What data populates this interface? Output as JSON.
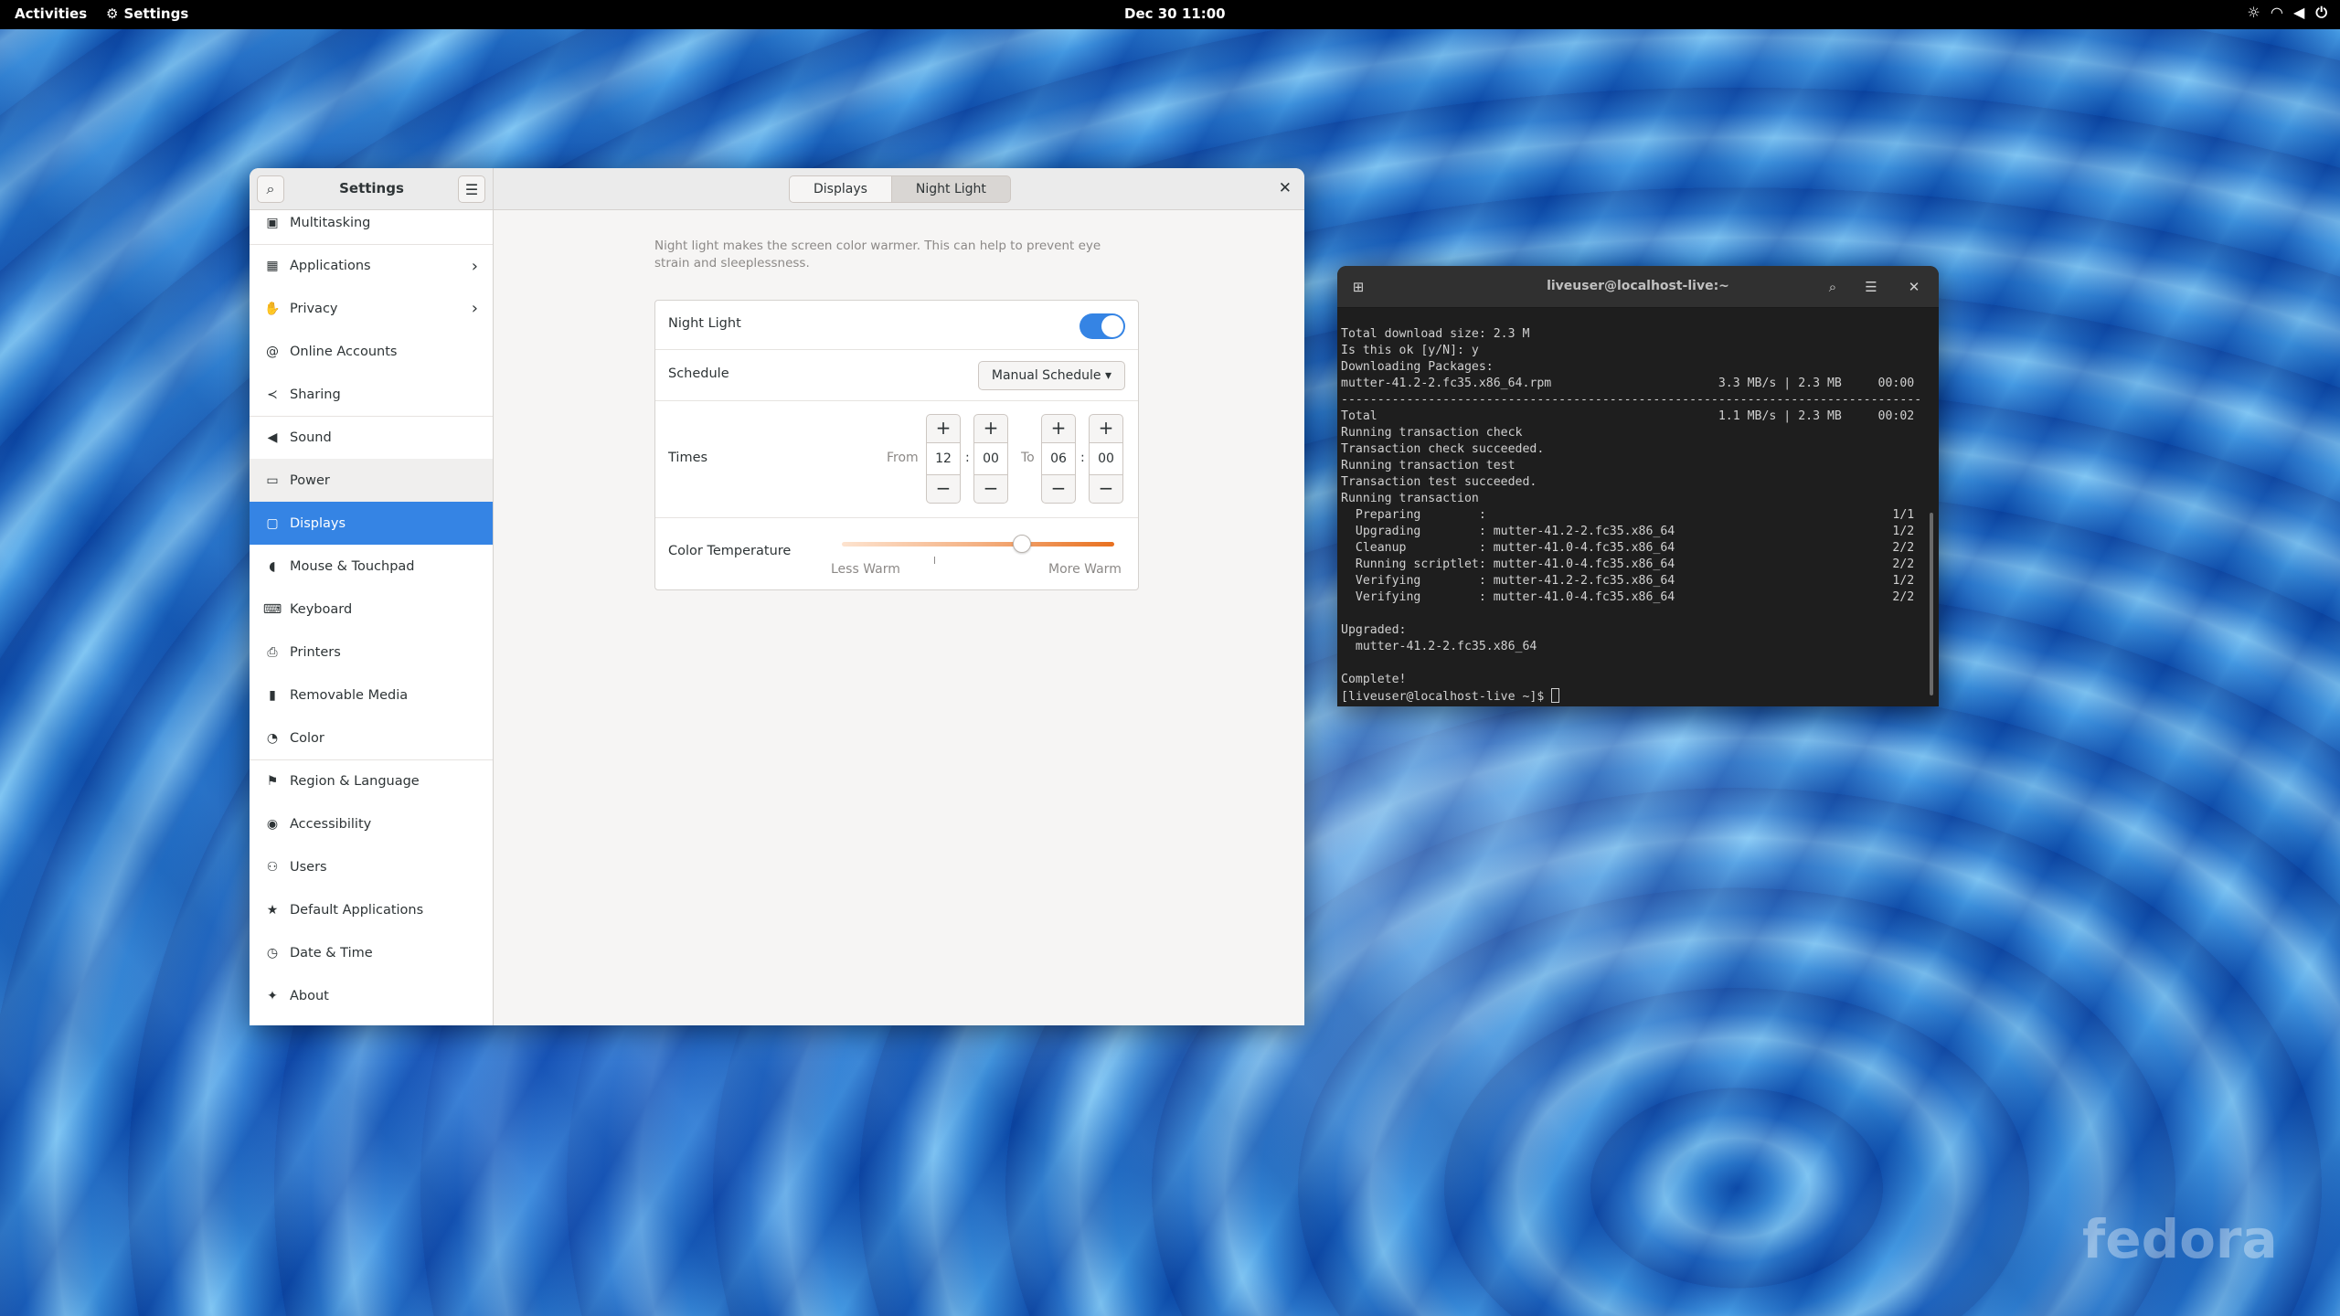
{
  "topbar": {
    "activities": "Activities",
    "app_name": "Settings",
    "clock": "Dec 30  11:00"
  },
  "settings": {
    "title": "Settings",
    "tabs": [
      {
        "label": "Displays"
      },
      {
        "label": "Night Light"
      }
    ],
    "active_tab": "Night Light",
    "sidebar": {
      "items": [
        {
          "label": "Multitasking",
          "icon": "multitasking-icon"
        },
        {
          "label": "Applications",
          "icon": "applications-icon"
        },
        {
          "label": "Privacy",
          "icon": "privacy-icon"
        },
        {
          "label": "Online Accounts",
          "icon": "online-accounts-icon"
        },
        {
          "label": "Sharing",
          "icon": "sharing-icon"
        },
        {
          "label": "Sound",
          "icon": "sound-icon"
        },
        {
          "label": "Power",
          "icon": "power-icon"
        },
        {
          "label": "Displays",
          "icon": "displays-icon"
        },
        {
          "label": "Mouse & Touchpad",
          "icon": "mouse-icon"
        },
        {
          "label": "Keyboard",
          "icon": "keyboard-icon"
        },
        {
          "label": "Printers",
          "icon": "printer-icon"
        },
        {
          "label": "Removable Media",
          "icon": "removable-media-icon"
        },
        {
          "label": "Color",
          "icon": "color-icon"
        },
        {
          "label": "Region & Language",
          "icon": "region-icon"
        },
        {
          "label": "Accessibility",
          "icon": "accessibility-icon"
        },
        {
          "label": "Users",
          "icon": "users-icon"
        },
        {
          "label": "Default Applications",
          "icon": "default-apps-icon"
        },
        {
          "label": "Date & Time",
          "icon": "clock-icon"
        },
        {
          "label": "About",
          "icon": "about-icon"
        }
      ],
      "active": "Displays"
    },
    "night_light": {
      "description": "Night light makes the screen color warmer. This can help to prevent eye strain and sleeplessness.",
      "toggle_label": "Night Light",
      "toggle_on": true,
      "schedule_label": "Schedule",
      "schedule_value": "Manual Schedule",
      "times_label": "Times",
      "from_label": "From",
      "to_label": "To",
      "from_hour": "12",
      "from_min": "00",
      "to_hour": "06",
      "to_min": "00",
      "color_temp_label": "Color Temperature",
      "less_warm": "Less Warm",
      "more_warm": "More Warm",
      "color_temp_fraction": 0.66
    }
  },
  "terminal": {
    "title": "liveuser@localhost-live:~",
    "lines": [
      "Total download size: 2.3 M",
      "Is this ok [y/N]: y",
      "Downloading Packages:",
      "mutter-41.2-2.fc35.x86_64.rpm                       3.3 MB/s | 2.3 MB     00:00",
      "--------------------------------------------------------------------------------",
      "Total                                               1.1 MB/s | 2.3 MB     00:02",
      "Running transaction check",
      "Transaction check succeeded.",
      "Running transaction test",
      "Transaction test succeeded.",
      "Running transaction",
      "  Preparing        :                                                        1/1",
      "  Upgrading        : mutter-41.2-2.fc35.x86_64                              1/2",
      "  Cleanup          : mutter-41.0-4.fc35.x86_64                              2/2",
      "  Running scriptlet: mutter-41.0-4.fc35.x86_64                              2/2",
      "  Verifying        : mutter-41.2-2.fc35.x86_64                              1/2",
      "  Verifying        : mutter-41.0-4.fc35.x86_64                              2/2",
      "",
      "Upgraded:",
      "  mutter-41.2-2.fc35.x86_64",
      "",
      "Complete!"
    ],
    "prompt": "[liveuser@localhost-live ~]$ "
  },
  "watermark": "fedora",
  "colors": {
    "accent": "#3584e4",
    "terminal_bg": "#1e1e1e",
    "topbar_bg": "#000000"
  }
}
